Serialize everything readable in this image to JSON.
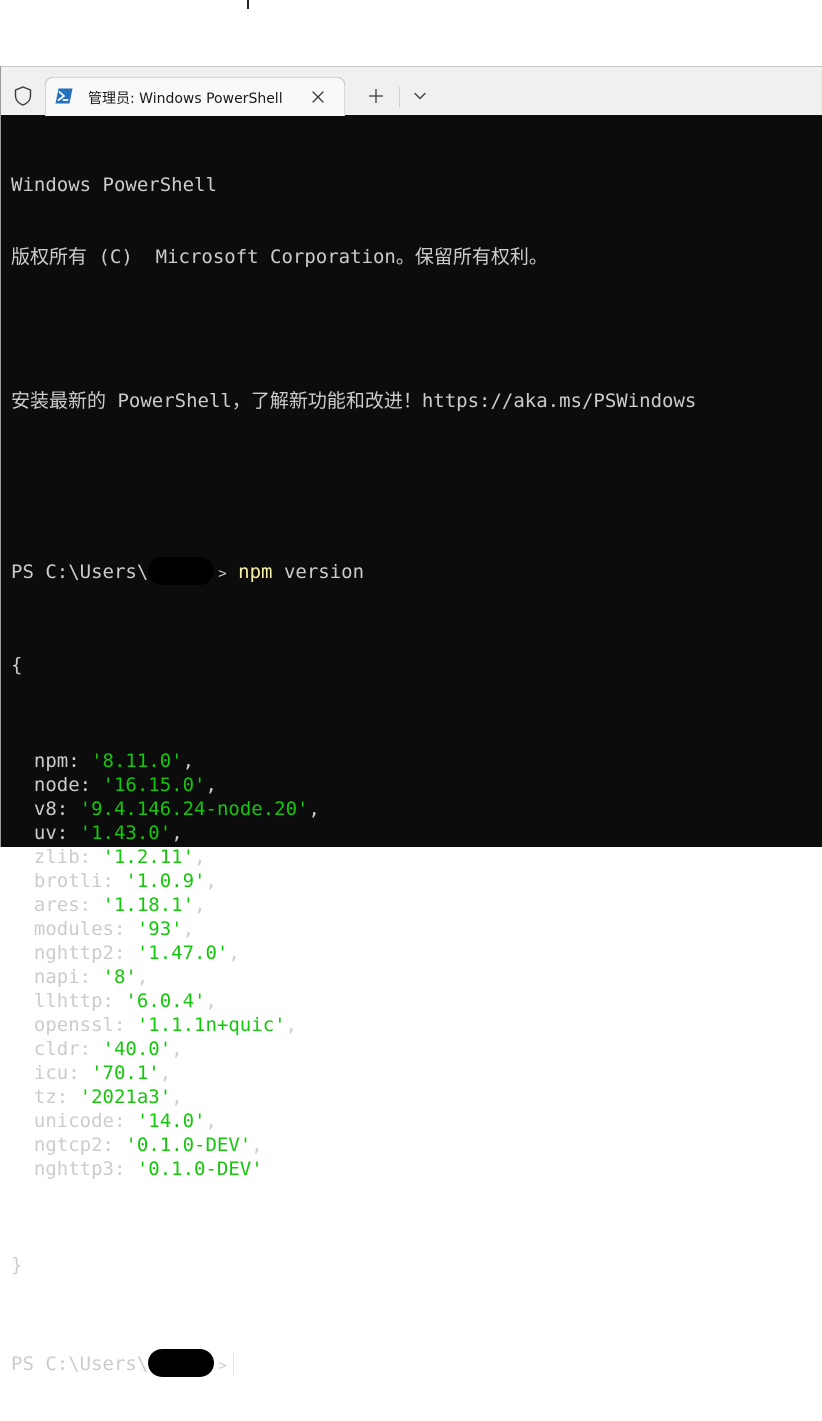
{
  "tab": {
    "title": "管理员: Windows PowerShell"
  },
  "console": {
    "banner_line1": "Windows PowerShell",
    "banner_line2": "版权所有 (C)  Microsoft Corporation。保留所有权利。",
    "banner_line3": "安装最新的 PowerShell，了解新功能和改进！https://aka.ms/PSWindows",
    "prompt_prefix": "PS C:\\Users\\",
    "prompt_suffix": ">",
    "command_name": "npm",
    "command_arg": " version",
    "open_brace": "{",
    "close_brace": "}",
    "versions": [
      {
        "key": "npm",
        "value": "'8.11.0'",
        "sep": ","
      },
      {
        "key": "node",
        "value": "'16.15.0'",
        "sep": ","
      },
      {
        "key": "v8",
        "value": "'9.4.146.24-node.20'",
        "sep": ","
      },
      {
        "key": "uv",
        "value": "'1.43.0'",
        "sep": ","
      },
      {
        "key": "zlib",
        "value": "'1.2.11'",
        "sep": ","
      },
      {
        "key": "brotli",
        "value": "'1.0.9'",
        "sep": ","
      },
      {
        "key": "ares",
        "value": "'1.18.1'",
        "sep": ","
      },
      {
        "key": "modules",
        "value": "'93'",
        "sep": ","
      },
      {
        "key": "nghttp2",
        "value": "'1.47.0'",
        "sep": ","
      },
      {
        "key": "napi",
        "value": "'8'",
        "sep": ","
      },
      {
        "key": "llhttp",
        "value": "'6.0.4'",
        "sep": ","
      },
      {
        "key": "openssl",
        "value": "'1.1.1n+quic'",
        "sep": ","
      },
      {
        "key": "cldr",
        "value": "'40.0'",
        "sep": ","
      },
      {
        "key": "icu",
        "value": "'70.1'",
        "sep": ","
      },
      {
        "key": "tz",
        "value": "'2021a3'",
        "sep": ","
      },
      {
        "key": "unicode",
        "value": "'14.0'",
        "sep": ","
      },
      {
        "key": "ngtcp2",
        "value": "'0.1.0-DEV'",
        "sep": ","
      },
      {
        "key": "nghttp3",
        "value": "'0.1.0-DEV'",
        "sep": ""
      }
    ]
  },
  "colors": {
    "console_bg": "#0c0c0c",
    "console_text": "#cccccc",
    "command_yellow": "#f9f1a5",
    "string_green": "#16c60c"
  },
  "icons": {
    "shield": "shield-icon",
    "tab_app": "powershell-icon",
    "close": "close-icon",
    "new_tab": "plus-icon",
    "dropdown": "chevron-down-icon"
  }
}
